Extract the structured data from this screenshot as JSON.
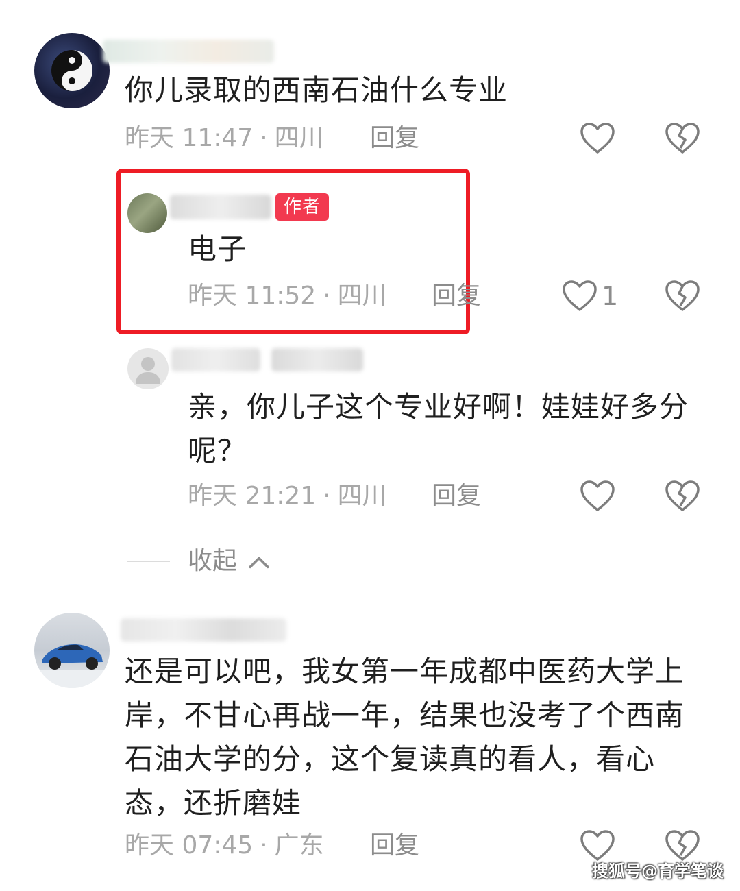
{
  "comments": [
    {
      "text": "你儿录取的西南石油什么专业",
      "time": "昨天 11:47",
      "location": "四川",
      "reply_label": "回复"
    },
    {
      "badge": "作者",
      "text": "电子",
      "time": "昨天 11:52",
      "location": "四川",
      "reply_label": "回复",
      "like_count": "1"
    },
    {
      "text": "亲，你儿子这个专业好啊！娃娃好多分呢？",
      "time": "昨天 21:21",
      "location": "四川",
      "reply_label": "回复"
    },
    {
      "text": "还是可以吧，我女第一年成都中医药大学上岸，不甘心再战一年，结果也没考了个西南石油大学的分，这个复读真的看人，看心态，还折磨娃",
      "time": "昨天 07:45",
      "location": "广东",
      "reply_label": "回复"
    }
  ],
  "collapse_label": "收起",
  "watermark": "搜狐号@育学笔谈",
  "colors": {
    "badge": "#f2394f",
    "highlight_border": "#ee1c25",
    "meta_text": "#a8a8a8"
  }
}
